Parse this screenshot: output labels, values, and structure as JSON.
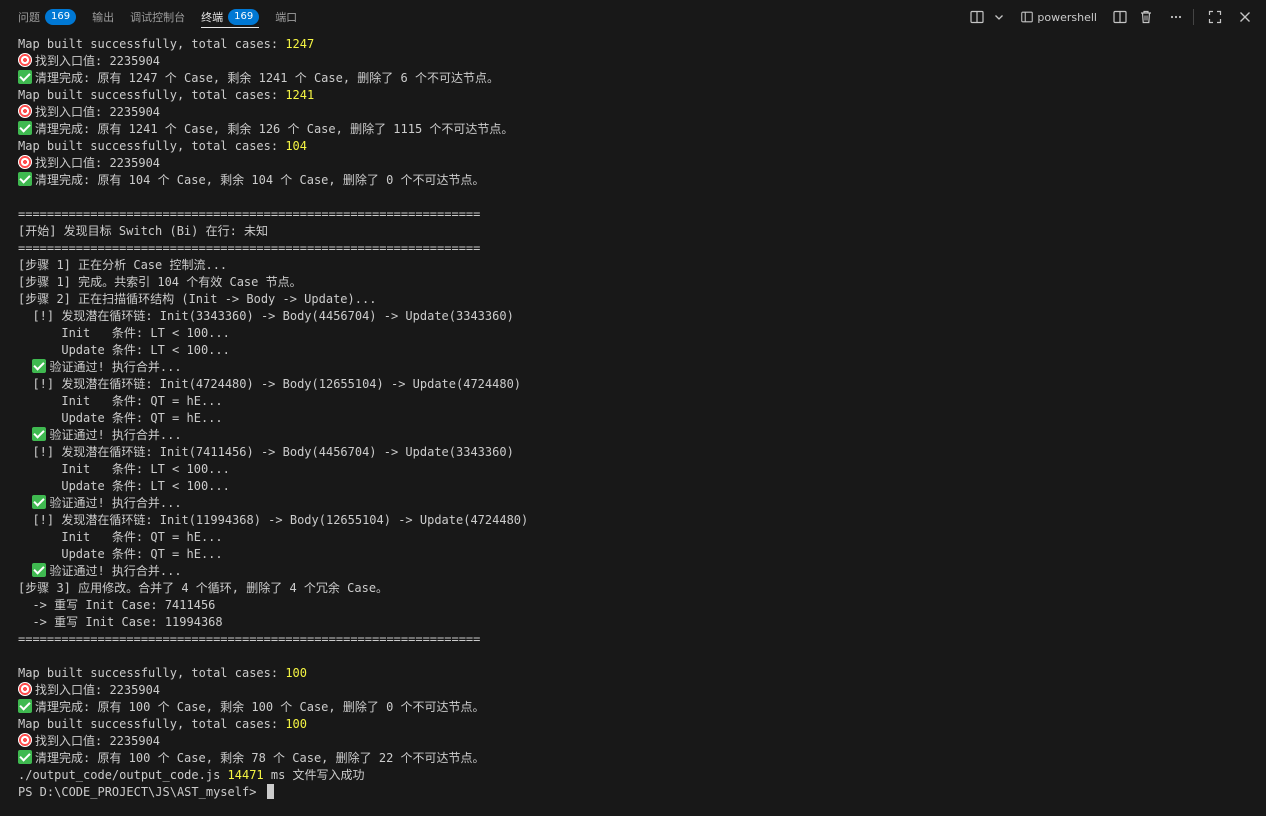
{
  "tabs": [
    {
      "label": "问题",
      "badge": "169"
    },
    {
      "label": "输出",
      "badge": ""
    },
    {
      "label": "调试控制台",
      "badge": ""
    },
    {
      "label": "终端",
      "badge": "169"
    },
    {
      "label": "端口",
      "badge": ""
    }
  ],
  "active_tab": 3,
  "toolbar": {
    "shell_label": "powershell"
  },
  "icons": {
    "new_terminal": "split-layout-icon",
    "dropdown": "chevron-down-icon",
    "shell": "terminal-icon",
    "split": "split-icon",
    "trash": "trash-icon",
    "more": "ellipsis-icon",
    "maximize": "maximize-icon",
    "close": "close-icon"
  },
  "colors": {
    "background": "#181818",
    "text": "#cccccc",
    "number_highlight": "#f5f543",
    "badge": "#0078d4"
  },
  "terminal": {
    "lines": [
      [
        {
          "t": "Map built successfully, total cases: "
        },
        {
          "t": "1247",
          "c": "num"
        }
      ],
      [
        {
          "icon": "target"
        },
        {
          "t": "找到入口值: 2235904"
        }
      ],
      [
        {
          "icon": "check"
        },
        {
          "t": "清理完成: 原有 1247 个 Case, 剩余 1241 个 Case, 删除了 6 个不可达节点。"
        }
      ],
      [
        {
          "t": "Map built successfully, total cases: "
        },
        {
          "t": "1241",
          "c": "num"
        }
      ],
      [
        {
          "icon": "target"
        },
        {
          "t": "找到入口值: 2235904"
        }
      ],
      [
        {
          "icon": "check"
        },
        {
          "t": "清理完成: 原有 1241 个 Case, 剩余 126 个 Case, 删除了 1115 个不可达节点。"
        }
      ],
      [
        {
          "t": "Map built successfully, total cases: "
        },
        {
          "t": "104",
          "c": "num"
        }
      ],
      [
        {
          "icon": "target"
        },
        {
          "t": "找到入口值: 2235904"
        }
      ],
      [
        {
          "icon": "check"
        },
        {
          "t": "清理完成: 原有 104 个 Case, 剩余 104 个 Case, 删除了 0 个不可达节点。"
        }
      ],
      [
        {
          "t": ""
        }
      ],
      [
        {
          "t": "================================================================"
        }
      ],
      [
        {
          "t": "[开始] 发现目标 Switch (Bi) 在行: 未知"
        }
      ],
      [
        {
          "t": "================================================================"
        }
      ],
      [
        {
          "t": "[步骤 1] 正在分析 Case 控制流..."
        }
      ],
      [
        {
          "t": "[步骤 1] 完成。共索引 104 个有效 Case 节点。"
        }
      ],
      [
        {
          "t": "[步骤 2] 正在扫描循环结构 (Init -> Body -> Update)..."
        }
      ],
      [
        {
          "t": "  [!] 发现潜在循环链: Init(3343360) -> Body(4456704) -> Update(3343360)"
        }
      ],
      [
        {
          "t": "      Init   条件: LT < 100..."
        }
      ],
      [
        {
          "t": "      Update 条件: LT < 100..."
        }
      ],
      [
        {
          "t": "  "
        },
        {
          "icon": "check"
        },
        {
          "t": "验证通过! 执行合并..."
        }
      ],
      [
        {
          "t": "  [!] 发现潜在循环链: Init(4724480) -> Body(12655104) -> Update(4724480)"
        }
      ],
      [
        {
          "t": "      Init   条件: QT = hE..."
        }
      ],
      [
        {
          "t": "      Update 条件: QT = hE..."
        }
      ],
      [
        {
          "t": "  "
        },
        {
          "icon": "check"
        },
        {
          "t": "验证通过! 执行合并..."
        }
      ],
      [
        {
          "t": "  [!] 发现潜在循环链: Init(7411456) -> Body(4456704) -> Update(3343360)"
        }
      ],
      [
        {
          "t": "      Init   条件: LT < 100..."
        }
      ],
      [
        {
          "t": "      Update 条件: LT < 100..."
        }
      ],
      [
        {
          "t": "  "
        },
        {
          "icon": "check"
        },
        {
          "t": "验证通过! 执行合并..."
        }
      ],
      [
        {
          "t": "  [!] 发现潜在循环链: Init(11994368) -> Body(12655104) -> Update(4724480)"
        }
      ],
      [
        {
          "t": "      Init   条件: QT = hE..."
        }
      ],
      [
        {
          "t": "      Update 条件: QT = hE..."
        }
      ],
      [
        {
          "t": "  "
        },
        {
          "icon": "check"
        },
        {
          "t": "验证通过! 执行合并..."
        }
      ],
      [
        {
          "t": "[步骤 3] 应用修改。合并了 4 个循环, 删除了 4 个冗余 Case。"
        }
      ],
      [
        {
          "t": "  -> 重写 Init Case: 7411456"
        }
      ],
      [
        {
          "t": "  -> 重写 Init Case: 11994368"
        }
      ],
      [
        {
          "t": "================================================================"
        }
      ],
      [
        {
          "t": ""
        }
      ],
      [
        {
          "t": "Map built successfully, total cases: "
        },
        {
          "t": "100",
          "c": "num"
        }
      ],
      [
        {
          "icon": "target"
        },
        {
          "t": "找到入口值: 2235904"
        }
      ],
      [
        {
          "icon": "check"
        },
        {
          "t": "清理完成: 原有 100 个 Case, 剩余 100 个 Case, 删除了 0 个不可达节点。"
        }
      ],
      [
        {
          "t": "Map built successfully, total cases: "
        },
        {
          "t": "100",
          "c": "num"
        }
      ],
      [
        {
          "icon": "target"
        },
        {
          "t": "找到入口值: 2235904"
        }
      ],
      [
        {
          "icon": "check"
        },
        {
          "t": "清理完成: 原有 100 个 Case, 剩余 78 个 Case, 删除了 22 个不可达节点。"
        }
      ],
      [
        {
          "t": "./output_code/output_code.js "
        },
        {
          "t": "14471",
          "c": "num"
        },
        {
          "t": " ms 文件写入成功"
        }
      ],
      [
        {
          "t": "PS D:\\CODE_PROJECT\\JS\\AST_myself> "
        },
        {
          "cursor": true
        }
      ]
    ]
  }
}
